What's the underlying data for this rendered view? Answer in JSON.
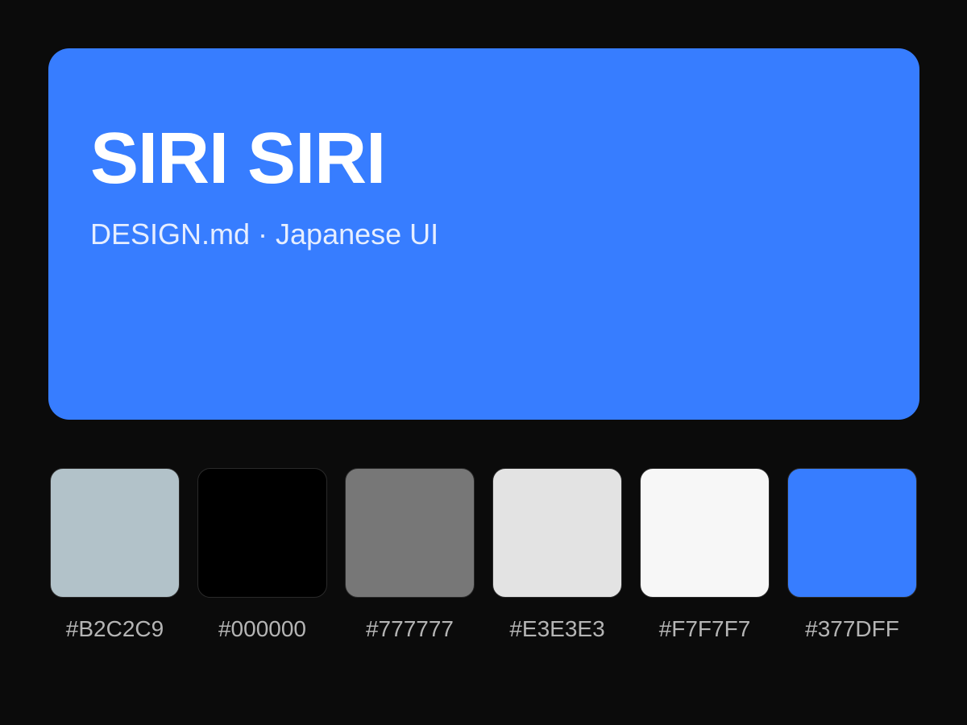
{
  "hero": {
    "title": "SIRI SIRI",
    "subtitle": "DESIGN.md · Japanese UI",
    "background": "#377DFF"
  },
  "palette": [
    {
      "label": "#B2C2C9",
      "color": "#B2C2C9"
    },
    {
      "label": "#000000",
      "color": "#000000"
    },
    {
      "label": "#777777",
      "color": "#777777"
    },
    {
      "label": "#E3E3E3",
      "color": "#E3E3E3"
    },
    {
      "label": "#F7F7F7",
      "color": "#F7F7F7"
    },
    {
      "label": "#377DFF",
      "color": "#377DFF"
    }
  ]
}
